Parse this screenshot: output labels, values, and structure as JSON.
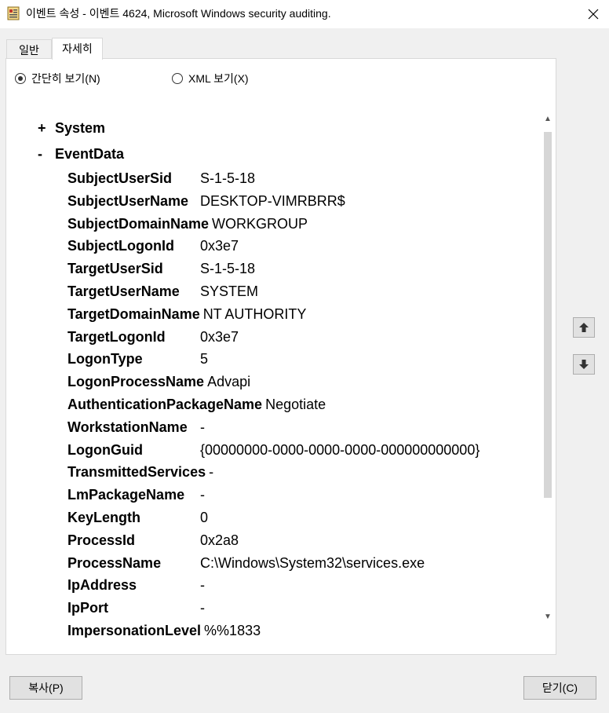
{
  "window": {
    "title": "이벤트 속성 - 이벤트 4624, Microsoft Windows security auditing.",
    "app_icon": "event-viewer-icon",
    "close_icon": "close-icon"
  },
  "tabs": [
    {
      "label": "일반",
      "active": false
    },
    {
      "label": "자세히",
      "active": true
    }
  ],
  "view_mode": {
    "friendly_label": "간단히 보기(N)",
    "friendly_selected": true,
    "xml_label": "XML 보기(X)",
    "xml_selected": false
  },
  "tree": {
    "system": {
      "toggle": "+",
      "label": "System"
    },
    "eventdata": {
      "toggle": "-",
      "label": "EventData"
    },
    "fields": [
      {
        "name": "SubjectUserSid",
        "value": "S-1-5-18"
      },
      {
        "name": "SubjectUserName",
        "value": "DESKTOP-VIMRBRR$"
      },
      {
        "name": "SubjectDomainName",
        "value": "WORKGROUP"
      },
      {
        "name": "SubjectLogonId",
        "value": "0x3e7"
      },
      {
        "name": "TargetUserSid",
        "value": "S-1-5-18"
      },
      {
        "name": "TargetUserName",
        "value": "SYSTEM"
      },
      {
        "name": "TargetDomainName",
        "value": "NT AUTHORITY"
      },
      {
        "name": "TargetLogonId",
        "value": "0x3e7"
      },
      {
        "name": "LogonType",
        "value": "5"
      },
      {
        "name": "LogonProcessName",
        "value": "Advapi"
      },
      {
        "name": "AuthenticationPackageName",
        "value": "Negotiate"
      },
      {
        "name": "WorkstationName",
        "value": "-"
      },
      {
        "name": "LogonGuid",
        "value": "{00000000-0000-0000-0000-000000000000}"
      },
      {
        "name": "TransmittedServices",
        "value": "-"
      },
      {
        "name": "LmPackageName",
        "value": "-"
      },
      {
        "name": "KeyLength",
        "value": "0"
      },
      {
        "name": "ProcessId",
        "value": "0x2a8"
      },
      {
        "name": "ProcessName",
        "value": "C:\\Windows\\System32\\services.exe"
      },
      {
        "name": "IpAddress",
        "value": "-"
      },
      {
        "name": "IpPort",
        "value": "-"
      },
      {
        "name": "ImpersonationLevel",
        "value": "%%1833"
      }
    ]
  },
  "nav": {
    "up_icon": "arrow-up-icon",
    "down_icon": "arrow-down-icon"
  },
  "buttons": {
    "copy": "복사(P)",
    "close": "닫기(C)"
  }
}
